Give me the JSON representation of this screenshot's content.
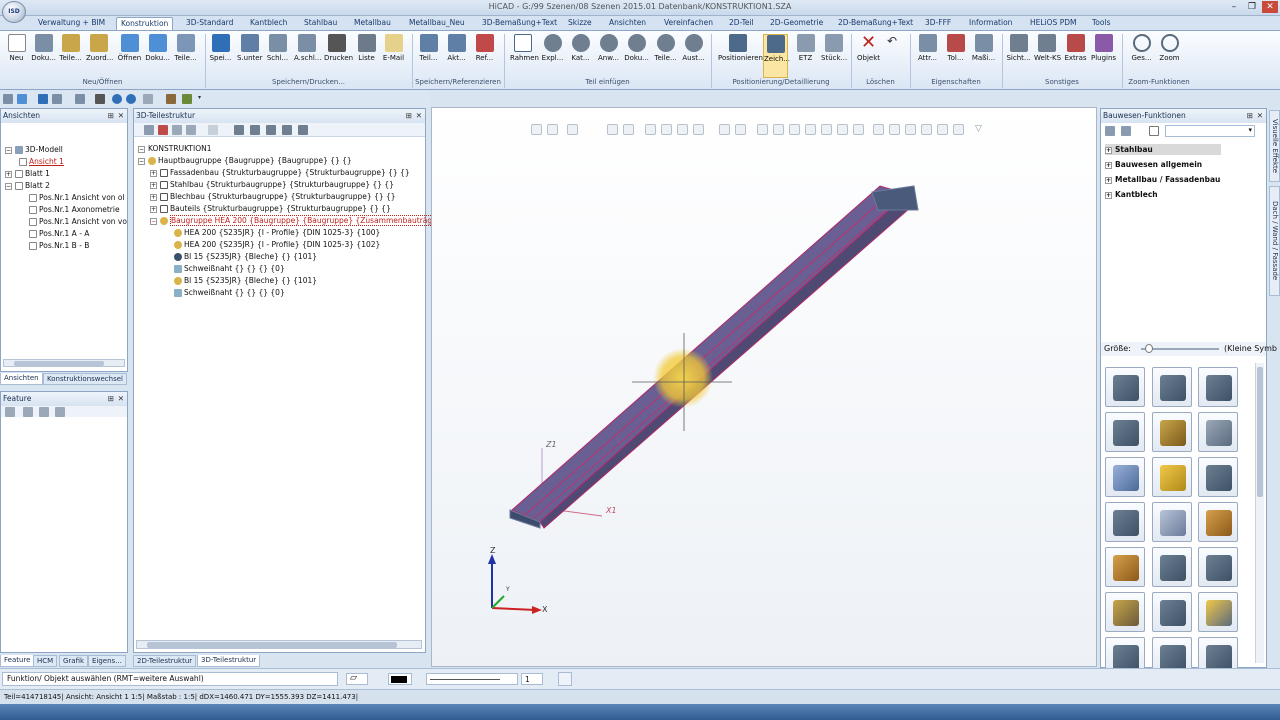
{
  "app": {
    "title": "HiCAD - G:/99 Szenen/08 Szenen 2015.01 Datenbank/KONSTRUKTION1.SZA",
    "button_logo": "ISD"
  },
  "window_controls": [
    "–",
    "❐",
    "✕"
  ],
  "tabs": [
    "Verwaltung + BIM",
    "Konstruktion",
    "3D-Standard",
    "Kantblech",
    "Stahlbau",
    "Metallbau",
    "Metallbau_Neu",
    "3D-Bemaßung+Text",
    "Skizze",
    "Ansichten",
    "Vereinfachen",
    "2D-Teil",
    "2D-Geometrie",
    "2D-Bemaßung+Text",
    "3D-FFF",
    "Information",
    "HELiOS PDM",
    "Tools"
  ],
  "ribbon": {
    "buttons": [
      "Neu",
      "Doku...",
      "Teile...",
      "Zuord...",
      "Öffnen",
      "Doku...",
      "Teile...",
      "Spei...",
      "S.unter",
      "Schl...",
      "A.schl...",
      "Drucken",
      "Liste",
      "E-Mail",
      "Teil...",
      "Akt...",
      "Ref...",
      "Rahmen",
      "Expl...",
      "Kat...",
      "Anw...",
      "Doku...",
      "Teile...",
      "Aust...",
      "Positionieren",
      "Zeich...",
      "ETZ",
      "Stück...",
      "Objekt",
      "Attr...",
      "Tol...",
      "Maßi...",
      "Sicht...",
      "Welt-KS",
      "Extras",
      "Plugins",
      "Ges...",
      "Zoom"
    ],
    "groups": [
      "Neu/Öffnen",
      "Speichern/Drucken...",
      "Speichern/Referenzieren",
      "Teil einfügen",
      "Positionierung/Detaillierung",
      "Löschen",
      "Eigenschaften",
      "Sonstiges",
      "Zoom-Funktionen"
    ]
  },
  "ansichten": {
    "title": "Ansichten",
    "items": [
      "3D-Modell",
      "Ansicht 1",
      "Blatt 1",
      "Blatt 2",
      "Pos.Nr.1 Ansicht von ol",
      "Pos.Nr.1 Axonometrie",
      "Pos.Nr.1 Ansicht von vo",
      "Pos.Nr.1 A - A",
      "Pos.Nr.1 B - B"
    ],
    "tabs": [
      "Ansichten",
      "Konstruktionswechsel"
    ]
  },
  "feature": {
    "title": "Feature"
  },
  "bottom_tabs": [
    "Feature",
    "HCM",
    "Grafik",
    "Eigens...",
    "2D-Teilestruktur",
    "3D-Teilestruktur"
  ],
  "teilestruktur": {
    "title": "3D-Teilestruktur",
    "items": [
      "KONSTRUKTION1",
      "Hauptbaugruppe {Baugruppe} {Baugruppe} {} {}",
      "Fassadenbau {Strukturbaugruppe} {Strukturbaugruppe} {} {}",
      "Stahlbau {Strukturbaugruppe} {Strukturbaugruppe} {} {}",
      "Blechbau {Strukturbaugruppe} {Strukturbaugruppe} {} {}",
      "Bauteils {Strukturbaugruppe} {Strukturbaugruppe} {} {}",
      "Baugruppe HEA 200 {Baugruppe} {Baugruppe} {Zusammenbauträger",
      "HEA 200 {S235JR} {I - Profile} {DIN 1025-3} {100}",
      "HEA 200 {S235JR} {I - Profile} {DIN 1025-3} {102}",
      "Bl 15 {S235JR} {Bleche} {} {101}",
      "Schweißnaht {} {} {} {0}",
      "Bl 15 {S235JR} {Bleche} {} {101}",
      "Schweißnaht {} {} {} {0}"
    ]
  },
  "viewport": {
    "axis_z1": "Z1",
    "axis_x1": "X1",
    "triad_z": "Z",
    "triad_x": "X",
    "triad_y": "Y"
  },
  "bauwesen": {
    "title": "Bauwesen-Funktionen",
    "items": [
      "Stahlbau",
      "Bauwesen allgemein",
      "Metallbau / Fassadenbau",
      "Kantblech"
    ],
    "size_label": "Größe:",
    "size_value": "(Kleine Symb",
    "side_tabs": [
      "Visuelle Effekte",
      "Dach / Wand / Fassade"
    ]
  },
  "status": {
    "prompt": "Funktion/ Objekt auswählen (RMT=weitere Auswahl)",
    "line_value": "1",
    "info": "Teil=414718145| Ansicht: Ansicht 1 1:5| Maßstab : 1:5| dDX=1460.471 DY=1555.393 DZ=1411.473|"
  },
  "colors": {
    "beam": "#6a5f93",
    "beam_edge": "#b0286a",
    "accent": "#dfe9f5",
    "highlight": "#f2d34a"
  }
}
